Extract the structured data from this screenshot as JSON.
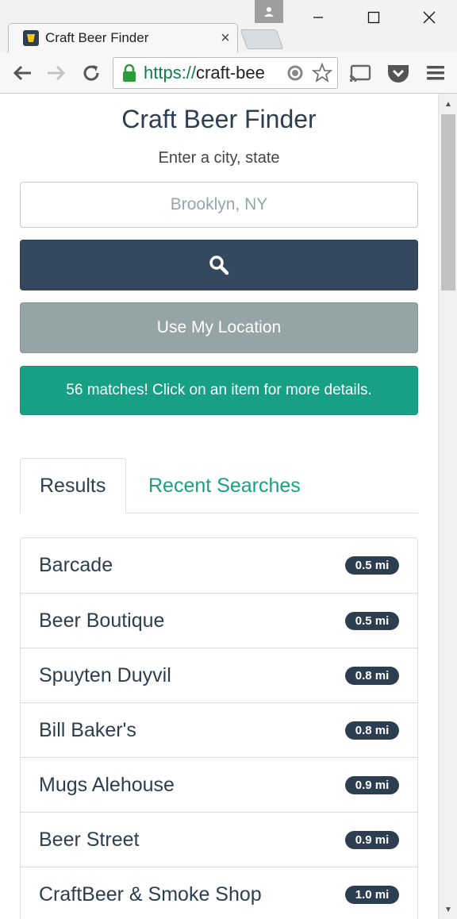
{
  "browser": {
    "tab_title": "Craft Beer Finder",
    "tab_close": "×",
    "url_scheme": "https://",
    "url_rest": "craft-bee"
  },
  "page": {
    "title": "Craft Beer Finder",
    "subtitle": "Enter a city, state",
    "search_placeholder": "Brooklyn, NY",
    "location_button": "Use My Location",
    "alert": "56 matches! Click on an item for more details."
  },
  "tabs": [
    {
      "label": "Results",
      "active": true
    },
    {
      "label": "Recent Searches",
      "active": false
    }
  ],
  "results": [
    {
      "name": "Barcade",
      "distance": "0.5 mi"
    },
    {
      "name": "Beer Boutique",
      "distance": "0.5 mi"
    },
    {
      "name": "Spuyten Duyvil",
      "distance": "0.8 mi"
    },
    {
      "name": "Bill Baker's",
      "distance": "0.8 mi"
    },
    {
      "name": "Mugs Alehouse",
      "distance": "0.9 mi"
    },
    {
      "name": "Beer Street",
      "distance": "0.9 mi"
    },
    {
      "name": "CraftBeer & Smoke Shop",
      "distance": "1.0 mi"
    }
  ],
  "colors": {
    "primary": "#2c3e50",
    "success": "#18a085",
    "muted": "#95a5a6"
  }
}
